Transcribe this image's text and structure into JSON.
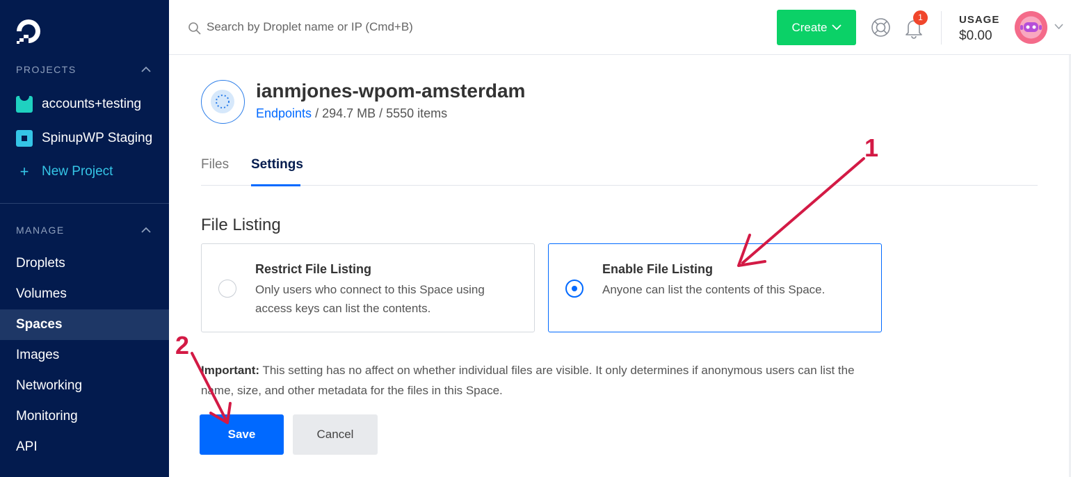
{
  "sidebar": {
    "logo_icon": "digitalocean-logo",
    "projects_heading": "PROJECTS",
    "projects": [
      {
        "label": "accounts+testing",
        "icon": "project-icon",
        "color": "#1fd1c0"
      },
      {
        "label": "SpinupWP Staging",
        "icon": "project-icon",
        "color": "#35c5e6"
      }
    ],
    "new_project_label": "New Project",
    "manage_heading": "MANAGE",
    "nav": [
      "Droplets",
      "Volumes",
      "Spaces",
      "Images",
      "Networking",
      "Monitoring",
      "API"
    ],
    "active_nav": "Spaces"
  },
  "topbar": {
    "search_placeholder": "Search by Droplet name or IP (Cmd+B)",
    "create_label": "Create",
    "notification_count": "1",
    "usage_label": "USAGE",
    "usage_value": "$0.00"
  },
  "space": {
    "name": "ianmjones-wpom-amsterdam",
    "endpoints_link": "Endpoints",
    "meta": " / 294.7 MB / 5550 items"
  },
  "tabs": [
    {
      "label": "Files",
      "active": false
    },
    {
      "label": "Settings",
      "active": true
    }
  ],
  "file_listing": {
    "title": "File Listing",
    "options": [
      {
        "title": "Restrict File Listing",
        "description": "Only users who connect to this Space using access keys can list the contents.",
        "selected": false
      },
      {
        "title": "Enable File Listing",
        "description": "Anyone can list the contents of this Space.",
        "selected": true
      }
    ],
    "important_label": "Important:",
    "important_text": " This setting has no affect on whether individual files are visible. It only determines if anonymous users can list the name, size, and other metadata for the files in this Space."
  },
  "actions": {
    "save_label": "Save",
    "cancel_label": "Cancel"
  },
  "annotations": {
    "color": "#d31a45",
    "step1": "1",
    "step2": "2"
  },
  "colors": {
    "sidebar_bg": "#031b4e",
    "accent_blue": "#0069ff",
    "create_green": "#0bd167",
    "badge_red": "#f0462c"
  }
}
